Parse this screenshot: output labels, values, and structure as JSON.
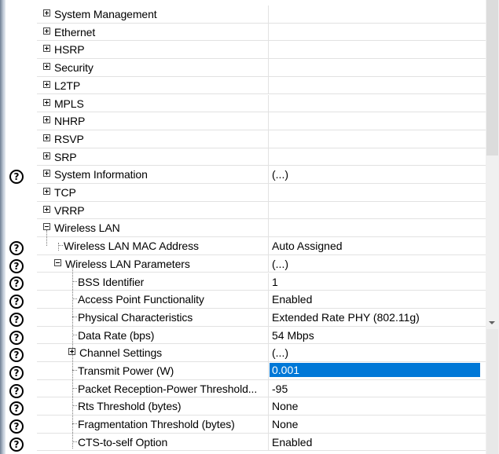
{
  "help_glyph": "?",
  "rows": [
    {
      "label": "System Management",
      "value": "",
      "expander": "plus",
      "help": false
    },
    {
      "label": "Ethernet",
      "value": "",
      "expander": "plus",
      "help": false
    },
    {
      "label": "HSRP",
      "value": "",
      "expander": "plus",
      "help": false
    },
    {
      "label": "Security",
      "value": "",
      "expander": "plus",
      "help": false
    },
    {
      "label": "L2TP",
      "value": "",
      "expander": "plus",
      "help": false
    },
    {
      "label": "MPLS",
      "value": "",
      "expander": "plus",
      "help": false
    },
    {
      "label": "NHRP",
      "value": "",
      "expander": "plus",
      "help": false
    },
    {
      "label": "RSVP",
      "value": "",
      "expander": "plus",
      "help": false
    },
    {
      "label": "SRP",
      "value": "",
      "expander": "plus",
      "help": false
    },
    {
      "label": "System Information",
      "value": "(...)",
      "expander": "plus",
      "help": true
    },
    {
      "label": "TCP",
      "value": "",
      "expander": "plus",
      "help": false
    },
    {
      "label": "VRRP",
      "value": "",
      "expander": "plus",
      "help": false
    },
    {
      "label": "Wireless LAN",
      "value": "",
      "expander": "minus",
      "help": false
    },
    {
      "label": "Wireless LAN MAC Address",
      "value": "Auto Assigned",
      "expander": "none",
      "help": true
    },
    {
      "label": "Wireless LAN Parameters",
      "value": "(...)",
      "expander": "minus",
      "help": true
    },
    {
      "label": "BSS Identifier",
      "value": "1",
      "expander": "none",
      "help": true
    },
    {
      "label": "Access Point Functionality",
      "value": "Enabled",
      "expander": "none",
      "help": true
    },
    {
      "label": "Physical Characteristics",
      "value": "Extended Rate PHY (802.11g)",
      "expander": "none",
      "help": true
    },
    {
      "label": "Data Rate (bps)",
      "value": "54 Mbps",
      "expander": "none",
      "help": true
    },
    {
      "label": "Channel Settings",
      "value": "(...)",
      "expander": "plus",
      "help": true
    },
    {
      "label": "Transmit Power (W)",
      "value": "0.001",
      "expander": "none",
      "help": true,
      "selected": true
    },
    {
      "label": "Packet Reception-Power Threshold...",
      "value": "-95",
      "expander": "none",
      "help": true
    },
    {
      "label": "Rts Threshold (bytes)",
      "value": "None",
      "expander": "none",
      "help": true
    },
    {
      "label": "Fragmentation Threshold (bytes)",
      "value": "None",
      "expander": "none",
      "help": true
    },
    {
      "label": "CTS-to-self Option",
      "value": "Enabled",
      "expander": "none",
      "help": true
    }
  ],
  "colors": {
    "selection": "#0078d7",
    "gridline": "#e2e2e2"
  }
}
